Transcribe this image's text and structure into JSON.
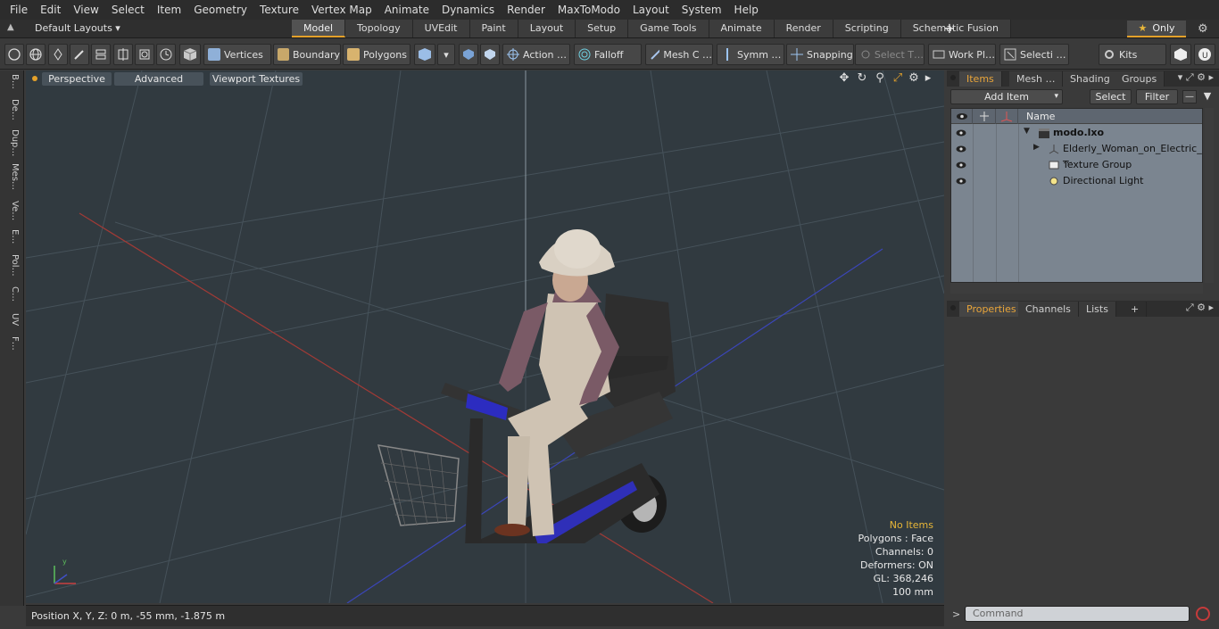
{
  "menu": [
    "File",
    "Edit",
    "View",
    "Select",
    "Item",
    "Geometry",
    "Texture",
    "Vertex Map",
    "Animate",
    "Dynamics",
    "Render",
    "MaxToModo",
    "Layout",
    "System",
    "Help"
  ],
  "layouts": {
    "dropdown": "Default Layouts ▾",
    "tabs": [
      "Model",
      "Topology",
      "UVEdit",
      "Paint",
      "Layout",
      "Setup",
      "Game Tools",
      "Animate",
      "Render",
      "Scripting",
      "Schematic Fusion"
    ],
    "plus": "+",
    "only": "Only"
  },
  "toolbar": {
    "vertices": "Vertices",
    "boundary": "Boundary",
    "polygons": "Polygons",
    "action": "Action …",
    "falloff": "Falloff",
    "mesh": "Mesh C …",
    "symm": "Symm …",
    "snapping": "Snapping",
    "select_t": "Select T…",
    "work_plane": "Work Pl…",
    "selecti": "Selecti …",
    "kits": "Kits"
  },
  "left_rail": [
    "B…",
    "De…",
    "Dup…",
    "Mes…",
    "Ve…",
    "E…",
    "Pol…",
    "C…",
    "UV",
    "F…"
  ],
  "viewport": {
    "perspective": "Perspective",
    "advanced": "Advanced",
    "textures": "Viewport Textures",
    "stats": {
      "no_items": "No Items",
      "polygons": "Polygons : Face",
      "channels": "Channels: 0",
      "deformers": "Deformers: ON",
      "gl": "GL: 368,246",
      "scale": "100 mm"
    }
  },
  "status": {
    "position": "Position X, Y, Z:   0 m, -55 mm, -1.875 m"
  },
  "items_panel": {
    "tabs": [
      "Items",
      "Mesh …",
      "Shading",
      "Groups"
    ],
    "add_item": "Add Item",
    "select": "Select",
    "filter": "Filter",
    "name_header": "Name",
    "rows": [
      {
        "name": "modo.lxo",
        "bold": true
      },
      {
        "name": "Elderly_Woman_on_Electric_ …",
        "bold": false
      },
      {
        "name": "Texture Group",
        "bold": false
      },
      {
        "name": "Directional Light",
        "bold": false
      }
    ]
  },
  "properties_panel": {
    "tabs": [
      "Properties",
      "Channels",
      "Lists"
    ],
    "plus": "+"
  },
  "command": {
    "placeholder": "Command"
  },
  "colors": {
    "accent": "#e4a12a",
    "viewport_bg": "#313a40",
    "x_axis": "#c0392b",
    "z_axis": "#3b46c4"
  }
}
